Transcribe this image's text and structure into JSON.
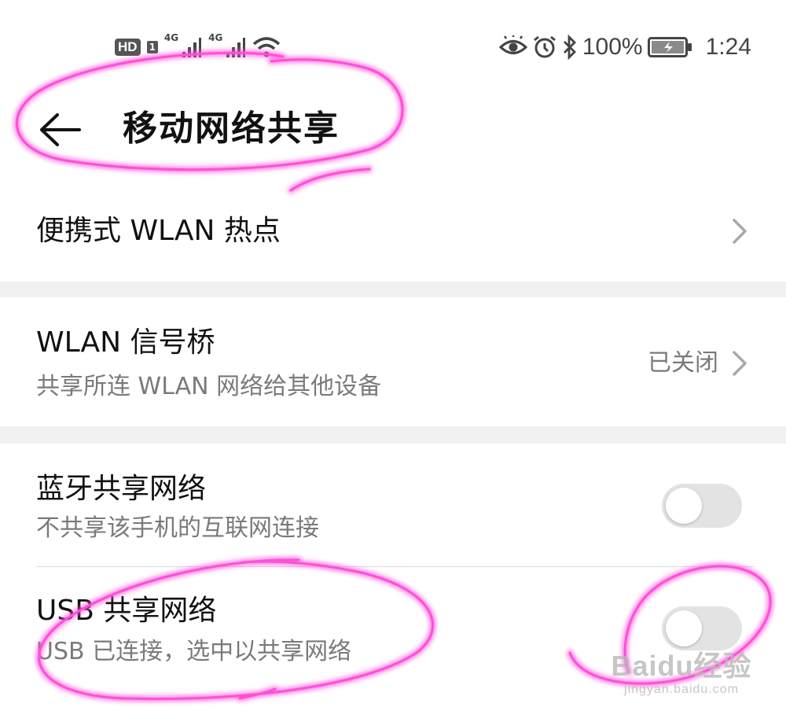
{
  "status_bar": {
    "hd_badge": "HD",
    "sim1": "1",
    "net1": "4G",
    "net2": "4G",
    "battery_percent": "100%",
    "time": "1:24",
    "icons": [
      "eye-comfort-icon",
      "alarm-icon",
      "bluetooth-icon",
      "battery-charging-icon",
      "wifi-icon",
      "signal-icon"
    ]
  },
  "header": {
    "title": "移动网络共享",
    "back_icon": "arrow-left-icon"
  },
  "settings": {
    "hotspot": {
      "title": "便携式 WLAN 热点"
    },
    "wlan_bridge": {
      "title": "WLAN 信号桥",
      "subtitle": "共享所连 WLAN 网络给其他设备",
      "status": "已关闭"
    },
    "bluetooth_tethering": {
      "title": "蓝牙共享网络",
      "subtitle": "不共享该手机的互联网连接",
      "enabled": false
    },
    "usb_tethering": {
      "title": "USB 共享网络",
      "subtitle": "USB 已连接，选中以共享网络",
      "enabled": false
    }
  },
  "watermark": {
    "logo": "Baidu经验",
    "url": "jingyan.baidu.com"
  },
  "colors": {
    "annotation": "#ff4fd8",
    "text_primary": "#111111",
    "text_secondary": "#7a7a7a",
    "toggle_off": "#e3e3e3",
    "section_gap": "#f1f1f1"
  }
}
